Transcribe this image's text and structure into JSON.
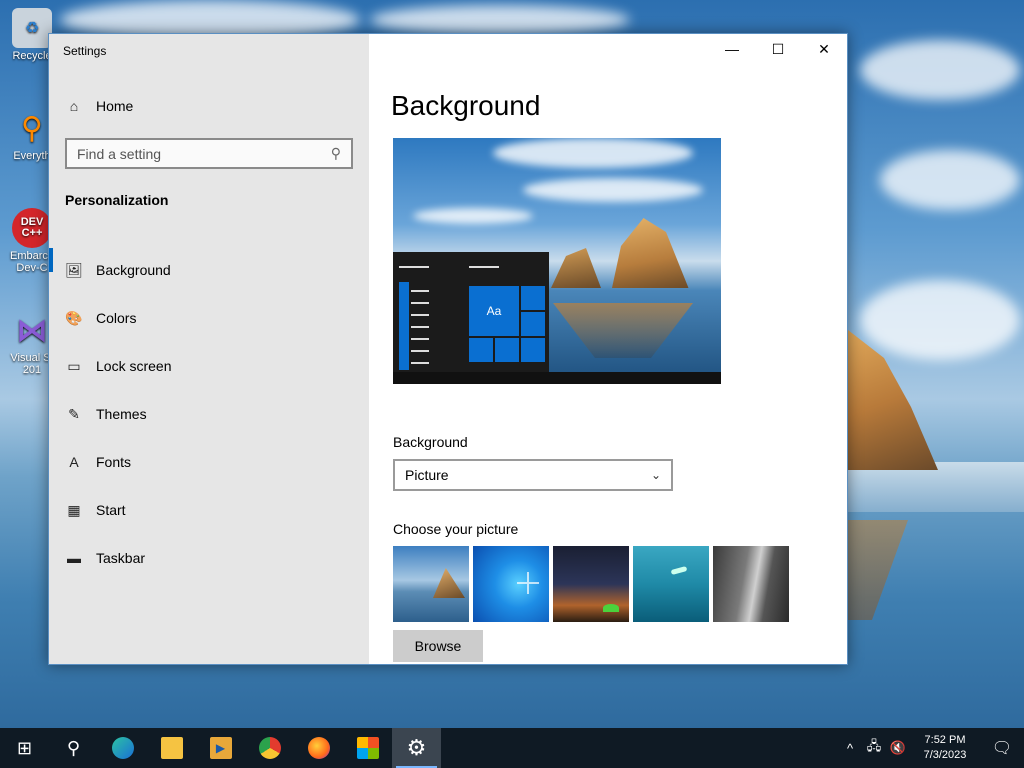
{
  "desktop": {
    "icons": [
      {
        "label": "Recycle",
        "icon": "recycle-bin-icon"
      },
      {
        "label": "Everyth",
        "icon": "everything-search-icon"
      },
      {
        "label": "Embarca\nDev-C",
        "icon": "devcpp-icon",
        "glyph": "DEV\nC++"
      },
      {
        "label": "Visual St\n201",
        "icon": "visual-studio-icon"
      }
    ]
  },
  "window": {
    "title": "Settings",
    "controls": {
      "minimize": "—",
      "maximize": "☐",
      "close": "✕"
    }
  },
  "sidebar": {
    "home_label": "Home",
    "home_icon": "⌂",
    "search_placeholder": "Find a setting",
    "search_icon": "⚲",
    "section_title": "Personalization",
    "items": [
      {
        "label": "Background",
        "icon": "🖼"
      },
      {
        "label": "Colors",
        "icon": "🎨"
      },
      {
        "label": "Lock screen",
        "icon": "▭"
      },
      {
        "label": "Themes",
        "icon": "✎"
      },
      {
        "label": "Fonts",
        "icon": "A"
      },
      {
        "label": "Start",
        "icon": "▦"
      },
      {
        "label": "Taskbar",
        "icon": "▬"
      }
    ]
  },
  "main": {
    "page_title": "Background",
    "preview_tile_text": "Aa",
    "background_label": "Background",
    "background_value": "Picture",
    "chevron": "⌄",
    "choose_label": "Choose your picture",
    "browse_label": "Browse"
  },
  "taskbar": {
    "start_icon": "⊞",
    "search_icon": "⚲",
    "clock_time": "7:52 PM",
    "clock_date": "7/3/2023",
    "tray_up": "^",
    "notification_icon": "🗨"
  },
  "colors": {
    "accent": "#0067c0",
    "sidebar_bg": "#e6e6e6",
    "taskbar_bg": "#0f1a24"
  }
}
